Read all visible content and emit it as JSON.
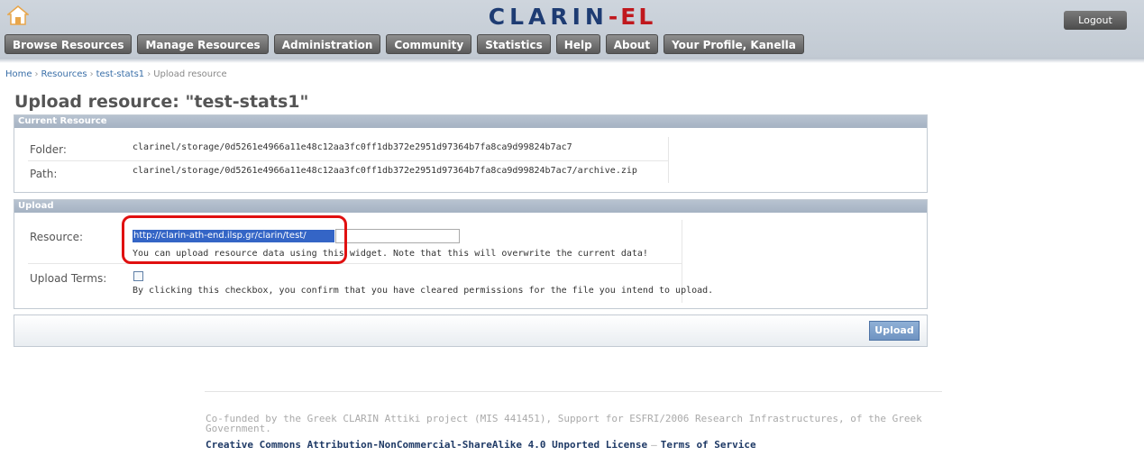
{
  "header": {
    "home_icon": "home-icon",
    "logo_main": "CLARIN",
    "logo_accent": "-EL",
    "logout_label": "Logout",
    "accent_color": "#1e3c73",
    "logo_accent_color": "#c0181d"
  },
  "nav": {
    "items": [
      {
        "label": "Browse Resources"
      },
      {
        "label": "Manage Resources"
      },
      {
        "label": "Administration"
      },
      {
        "label": "Community"
      },
      {
        "label": "Statistics"
      },
      {
        "label": "Help"
      },
      {
        "label": "About"
      },
      {
        "label": "Your Profile, Kanella"
      }
    ]
  },
  "breadcrumb": {
    "home": "Home",
    "resources": "Resources",
    "resource": "test-stats1",
    "current": "Upload resource",
    "separator": "›"
  },
  "page": {
    "title": "Upload resource: \"test-stats1\""
  },
  "current_resource": {
    "heading": "Current Resource",
    "folder_label": "Folder:",
    "folder_value": "clarinel/storage/0d5261e4966a11e48c12aa3fc0ff1db372e2951d97364b7fa8ca9d99824b7ac7",
    "path_label": "Path:",
    "path_value": "clarinel/storage/0d5261e4966a11e48c12aa3fc0ff1db372e2951d97364b7fa8ca9d99824b7ac7/archive.zip"
  },
  "upload": {
    "heading": "Upload",
    "resource_label": "Resource:",
    "resource_value": "http://clarin-ath-end.ilsp.gr/clarin/test/",
    "resource_help": "You can upload resource data using this widget. Note that this will overwrite the current data!",
    "terms_label": "Upload Terms:",
    "terms_checked": false,
    "terms_help": "By clicking this checkbox, you confirm that you have cleared permissions for the file you intend to upload.",
    "submit_label": "Upload"
  },
  "footer": {
    "funding": "Co-funded by the Greek CLARIN Attiki project (MIS 441451), Support for ESFRI/2006 Research Infrastructures, of the Greek Government.",
    "license": "Creative Commons Attribution-NonCommercial-ShareAlike 4.0 Unported License",
    "dash": "–",
    "terms": "Terms of Service"
  }
}
